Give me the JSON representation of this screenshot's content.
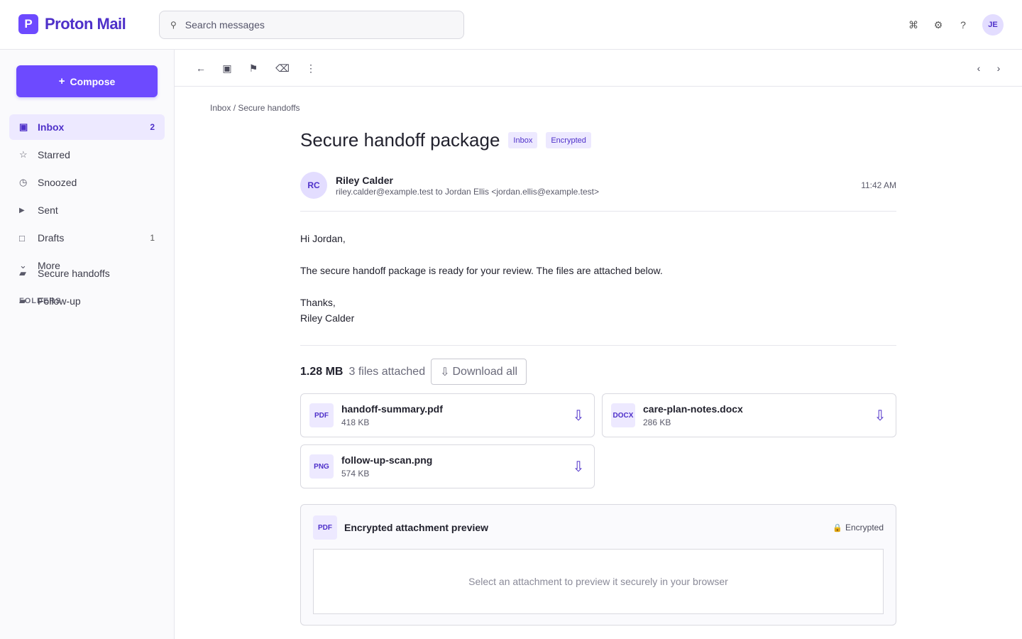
{
  "app": {
    "logo_letter": "P",
    "name": "Proton Mail"
  },
  "search": {
    "placeholder": "Search messages"
  },
  "header": {
    "icons": [
      "activity-icon",
      "gear-icon",
      "help-icon"
    ],
    "user_initials": "JE"
  },
  "sidebar": {
    "compose_label": "Compose",
    "items": [
      {
        "label": "Inbox",
        "count": "2",
        "icon": "inbox-icon",
        "active": true
      },
      {
        "label": "Starred",
        "count": "",
        "icon": "star-icon"
      },
      {
        "label": "Snoozed",
        "count": "",
        "icon": "clock-icon"
      },
      {
        "label": "Sent",
        "count": "",
        "icon": "send-icon"
      },
      {
        "label": "Drafts",
        "count": "1",
        "icon": "draft-icon"
      },
      {
        "label": "More",
        "count": "",
        "icon": "chevron-down-icon"
      }
    ],
    "folders_title": "FOLDERS",
    "folders": [
      {
        "label": "Secure handoffs",
        "icon": "folder-icon"
      },
      {
        "label": "Follow-up",
        "icon": "folder-icon"
      }
    ]
  },
  "toolbar": {
    "icons": [
      "back-icon",
      "archive-icon",
      "flag-icon",
      "delete-icon",
      "more-icon",
      "prev-icon",
      "next-icon"
    ]
  },
  "message": {
    "breadcrumb": "Inbox / Secure handoffs",
    "subject": "Secure handoff package",
    "tags": [
      "Inbox",
      "Encrypted"
    ],
    "sender_initials": "RC",
    "sender_name": "Riley Calder",
    "sender_address": "riley.calder@example.test to Jordan Ellis <jordan.ellis@example.test>",
    "time": "11:42 AM",
    "body": {
      "greeting": "Hi Jordan,",
      "paragraph": "The secure handoff package is ready for your review. The files are attached below.",
      "signoff": "Thanks,",
      "signature": "Riley Calder"
    }
  },
  "attachments": {
    "total_size": "1.28 MB",
    "count_text": "3 files attached",
    "download_all": "Download all",
    "files": [
      {
        "type": "PDF",
        "name": "handoff-summary.pdf",
        "size": "418 KB"
      },
      {
        "type": "DOCX",
        "name": "care-plan-notes.docx",
        "size": "286 KB"
      },
      {
        "type": "PNG",
        "name": "follow-up-scan.png",
        "size": "574 KB"
      }
    ]
  },
  "preview": {
    "type": "PDF",
    "title": "Encrypted attachment preview",
    "status": "Encrypted",
    "placeholder": "Select an attachment to preview it securely in your browser"
  },
  "colors": {
    "accent": "#6d4aff",
    "accent_dark": "#4e30c9",
    "accent_light": "#ede9ff"
  }
}
